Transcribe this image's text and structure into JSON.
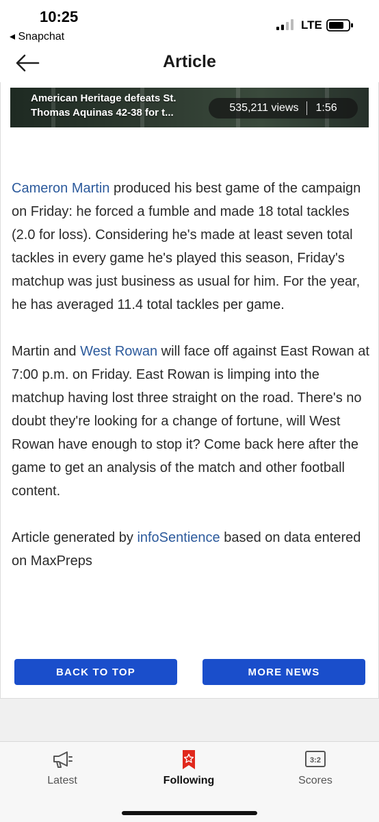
{
  "status_bar": {
    "time": "10:25",
    "back_app": "◂ Snapchat",
    "carrier": "LTE",
    "icons": [
      "signal-icon",
      "battery-icon"
    ]
  },
  "header": {
    "title": "Article",
    "back_icon": "arrow-left-icon"
  },
  "video": {
    "title": "American Heritage defeats St. Thomas Aquinas 42-38 for t...",
    "views": "535,211 views",
    "duration": "1:56"
  },
  "article": {
    "p1": {
      "link_name": "Cameron Martin",
      "text": " produced his best game of the campaign on Friday: he forced a fumble and made 18 total tackles (2.0 for loss). Considering he's made at least seven total tackles in every game he's played this season, Friday's matchup was just business as usual for him. For the year, he has averaged 11.4 total tackles per game."
    },
    "p2": {
      "text_before": "Martin and ",
      "link_team": "West Rowan",
      "text_after": " will face off against East Rowan at 7:00 p.m. on Friday. East Rowan is limping into the matchup having lost three straight on the road. There's no doubt they're looking for a change of fortune, will West Rowan have enough to stop it? Come back here after the game to get an analysis of the match and other football content."
    },
    "p3": {
      "text_before": "Article generated by ",
      "link_source": "infoSentience",
      "text_after": " based on data entered on MaxPreps"
    }
  },
  "buttons": {
    "back_to_top": "BACK TO TOP",
    "more_news": "MORE NEWS"
  },
  "tabs": [
    {
      "label": "Latest",
      "icon": "megaphone-icon",
      "active": false
    },
    {
      "label": "Following",
      "icon": "star-bookmark-icon",
      "active": true
    },
    {
      "label": "Scores",
      "icon": "scoreboard-icon",
      "active": false
    }
  ],
  "colors": {
    "accent_blue": "#1a4ecb",
    "link_blue": "#2c5a9c",
    "active_tab_red": "#e0281c"
  }
}
